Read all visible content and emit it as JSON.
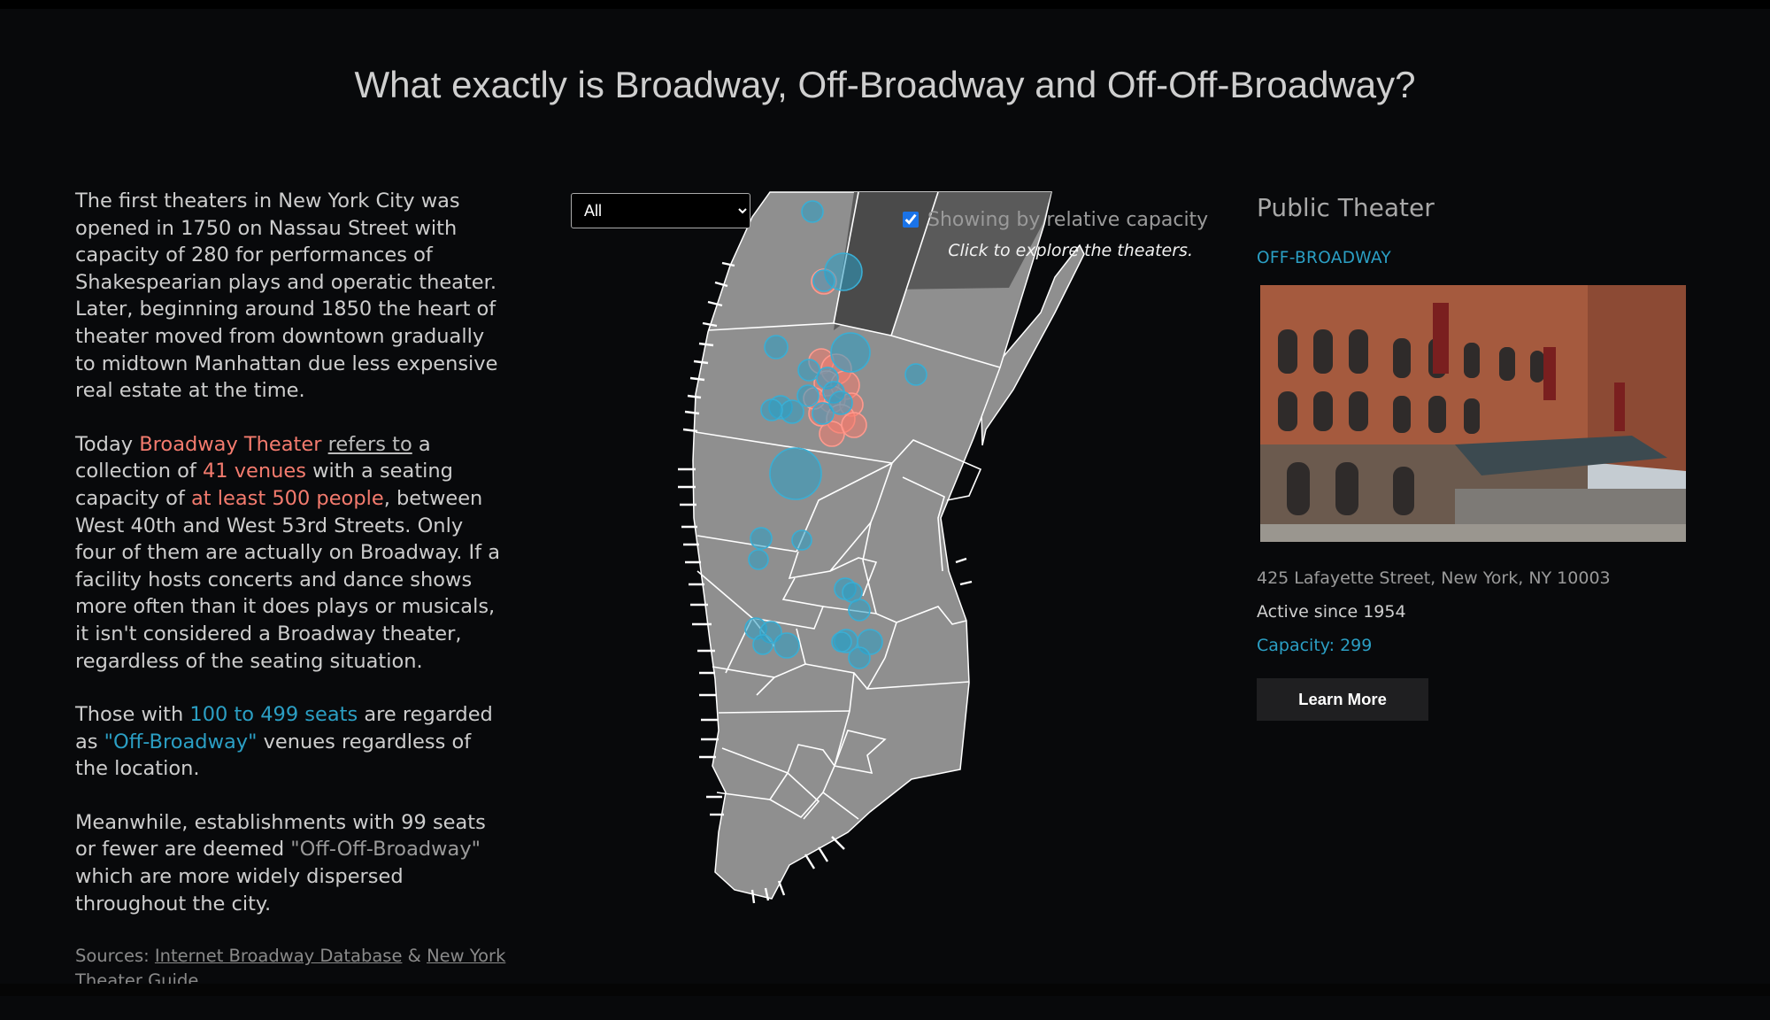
{
  "title": "What exactly is Broadway, Off-Broadway and Off-Off-Broadway?",
  "intro": {
    "p1": "The first theaters in New York City was opened in 1750 on Nassau Street with capacity of 280 for performances of Shakespearian plays and operatic theater. Later, beginning around 1850 the heart of theater moved from downtown gradually to midtown Manhattan due less expensive real estate at the time.",
    "p2_a": "Today ",
    "p2_bw": "Broadway Theater",
    "p2_b": " ",
    "p2_link": "refers to",
    "p2_c": " a collection of ",
    "p2_venues": "41 venues",
    "p2_d": " with a seating capacity of ",
    "p2_least": "at least 500 people",
    "p2_e": ", between West 40th and West 53rd Streets. Only four of them are actually on Broadway. If a facility hosts concerts and dance shows more often than it does plays or musicals, it isn't considered a Broadway theater, regardless of the seating situation.",
    "p3_a": "Those with ",
    "p3_seats": "100 to 499 seats",
    "p3_b": " are regarded as ",
    "p3_ob": "\"Off-Broadway\"",
    "p3_c": " venues regardless of the location.",
    "p4_a": "Meanwhile, establishments with 99 seats or fewer are deemed ",
    "p4_oob": "\"Off-Off-Broadway\"",
    "p4_b": " which are more widely dispersed throughout the city.",
    "sources_label": "Sources: ",
    "source1": "Internet Broadway Database",
    "sources_amp": " & ",
    "source2": "New York Theater Guide"
  },
  "controls": {
    "filter_selected": "All",
    "capacity_checked": true,
    "capacity_label": "Showing by relative capacity",
    "hint": "Click to explore the theaters."
  },
  "map": {
    "colors": {
      "land": "#8f8f8f",
      "border": "#ffffff",
      "broadway": "#f47b6e",
      "off_broadway": "#2b9fc4",
      "park": "#5c5c5c"
    }
  },
  "detail": {
    "name": "Public Theater",
    "category": "OFF-BROADWAY",
    "address": "425 Lafayette Street, New York, NY 10003",
    "since": "Active since 1954",
    "capacity": "Capacity: 299",
    "button": "Learn More",
    "photo_icon": "theater-photo"
  }
}
